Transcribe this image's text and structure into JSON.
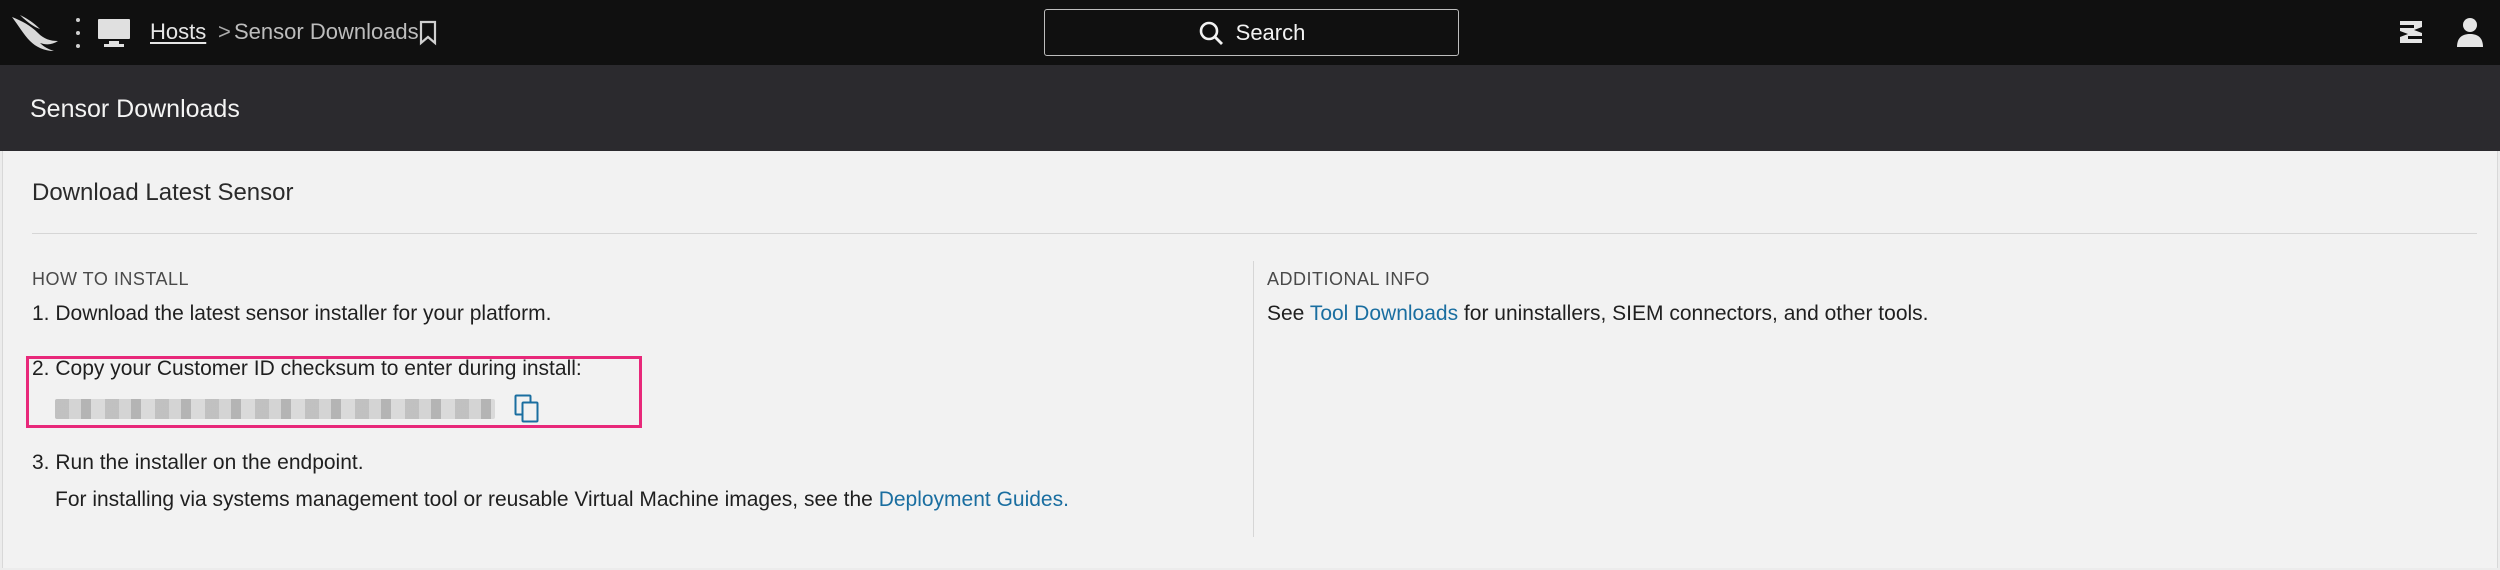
{
  "header": {
    "breadcrumb_root": "Hosts",
    "breadcrumb_separator": ">",
    "breadcrumb_current": "Sensor Downloads",
    "search_label": "Search"
  },
  "icons": {
    "logo": "falcon-logo-icon",
    "menu": "kebab-menu-icon",
    "section": "monitor-icon",
    "bookmark": "bookmark-icon",
    "search": "search-icon",
    "help": "support-icon",
    "account": "user-icon",
    "copy": "copy-icon"
  },
  "page": {
    "title": "Sensor Downloads",
    "panel_title": "Download Latest Sensor"
  },
  "how_to_install": {
    "label": "HOW TO INSTALL",
    "step1": "1. Download the latest sensor installer for your platform.",
    "step2": "2. Copy your Customer ID checksum to enter during install:",
    "step3": "3. Run the installer on the endpoint.",
    "step3_detail_prefix": "For installing via systems management tool or reusable Virtual Machine images, see the ",
    "step3_detail_link": "Deployment Guides",
    "step3_detail_suffix": "."
  },
  "additional_info": {
    "label": "ADDITIONAL INFO",
    "prefix": "See ",
    "link": "Tool Downloads",
    "suffix": " for uninstallers, SIEM connectors, and other tools."
  },
  "colors": {
    "topbar": "#101010",
    "subheader": "#2b2a2e",
    "link": "#1a6ea0",
    "highlight": "#e8287a"
  }
}
